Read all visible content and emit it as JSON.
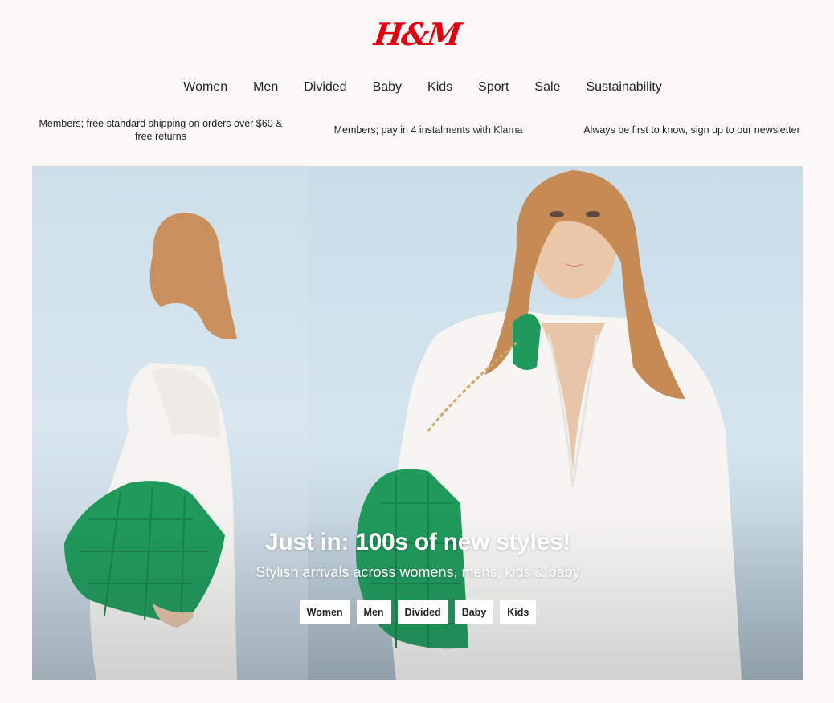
{
  "header": {
    "logo_text": "H&M",
    "brand_color": "#e50010"
  },
  "nav": {
    "items": [
      {
        "label": "Women"
      },
      {
        "label": "Men"
      },
      {
        "label": "Divided"
      },
      {
        "label": "Baby"
      },
      {
        "label": "Kids"
      },
      {
        "label": "Sport"
      },
      {
        "label": "Sale"
      },
      {
        "label": "Sustainability"
      }
    ]
  },
  "promos": [
    {
      "text": "Members; free standard shipping on orders over $60 & free returns"
    },
    {
      "text": "Members; pay in 4 instalments with Klarna"
    },
    {
      "text": "Always be first to know, sign up to our newsletter"
    }
  ],
  "hero": {
    "title": "Just in: 100s of new styles!",
    "subtitle": "Stylish arrivals across womens, mens, kids & baby",
    "buttons": [
      {
        "label": "Women"
      },
      {
        "label": "Men"
      },
      {
        "label": "Divided"
      },
      {
        "label": "Baby"
      },
      {
        "label": "Kids"
      }
    ]
  }
}
